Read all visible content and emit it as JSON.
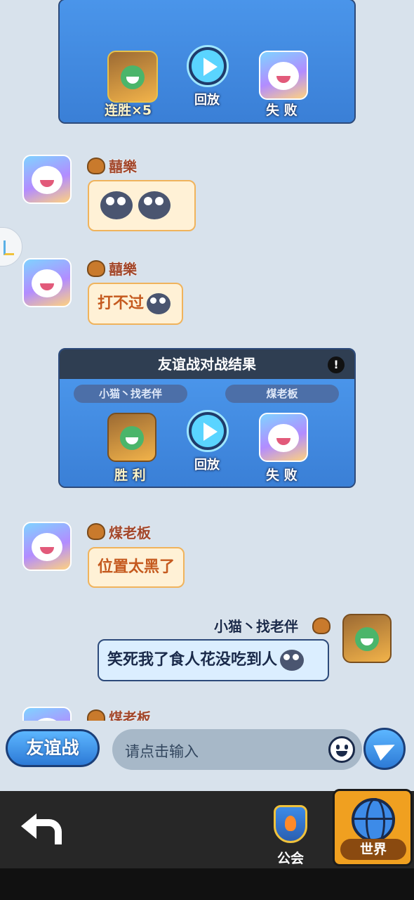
{
  "battle_card_1": {
    "left_label": "连胜×5",
    "replay_label": "回放",
    "right_label": "失 败"
  },
  "messages": [
    {
      "user": "囍樂",
      "text": ""
    },
    {
      "user": "囍樂",
      "text": "打不过"
    },
    {
      "user": "煤老板",
      "text": "位置太黑了"
    },
    {
      "user": "小猫丶找老伴",
      "text": "笑死我了食人花没吃到人"
    },
    {
      "user": "煤老板",
      "text": ""
    }
  ],
  "battle_card_2": {
    "title": "友谊战对战结果",
    "info_icon": "!",
    "player_left": "小猫丶找老伴",
    "player_right": "煤老板",
    "left_label": "胜 利",
    "replay_label": "回放",
    "right_label": "失 败"
  },
  "input_bar": {
    "friendly_button": "友谊战",
    "placeholder": "请点击输入"
  },
  "bottom_nav": {
    "guild_label": "公会",
    "world_label": "世界"
  },
  "colors": {
    "background": "#d8e2ec",
    "accent": "#3a7fd6",
    "bubble_other": "#fff1d6",
    "bubble_me": "#dbeeff",
    "nav_active": "#f0a020"
  }
}
